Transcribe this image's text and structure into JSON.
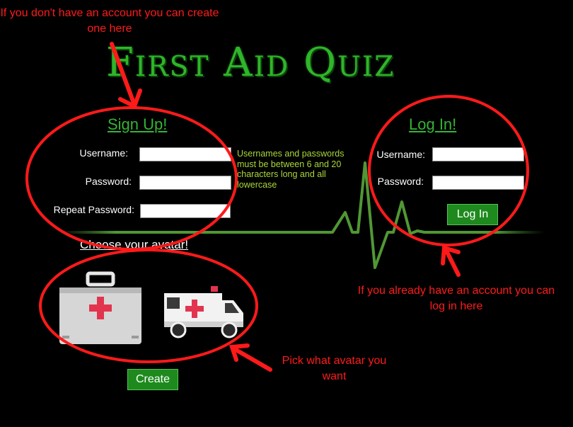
{
  "app": {
    "title": "First Aid Quiz"
  },
  "signup": {
    "heading": "Sign Up!",
    "username_label": "Username:",
    "password_label": "Password:",
    "repeat_password_label": "Repeat Password:",
    "username_value": "",
    "password_value": "",
    "repeat_password_value": "",
    "rules_note": "Usernames and passwords must be between 6 and 20 characters long and all lowercase"
  },
  "login": {
    "heading": "Log In!",
    "username_label": "Username:",
    "password_label": "Password:",
    "username_value": "",
    "password_value": "",
    "button_label": "Log In"
  },
  "avatar": {
    "heading": "Choose your avatar!",
    "options": [
      "first-aid-kit-icon",
      "ambulance-icon"
    ],
    "create_label": "Create"
  },
  "annotations": {
    "signup_hint": "If you don't have an account you can create one here",
    "login_hint": "If you already have an account you can log in here",
    "avatar_hint": "Pick what avatar you want"
  },
  "colors": {
    "background": "#000000",
    "accent_green": "#35b335",
    "button_green": "#1e8a1e",
    "annotation_red": "#ff1a1a",
    "heartbeat_line": "#5aa83a"
  }
}
